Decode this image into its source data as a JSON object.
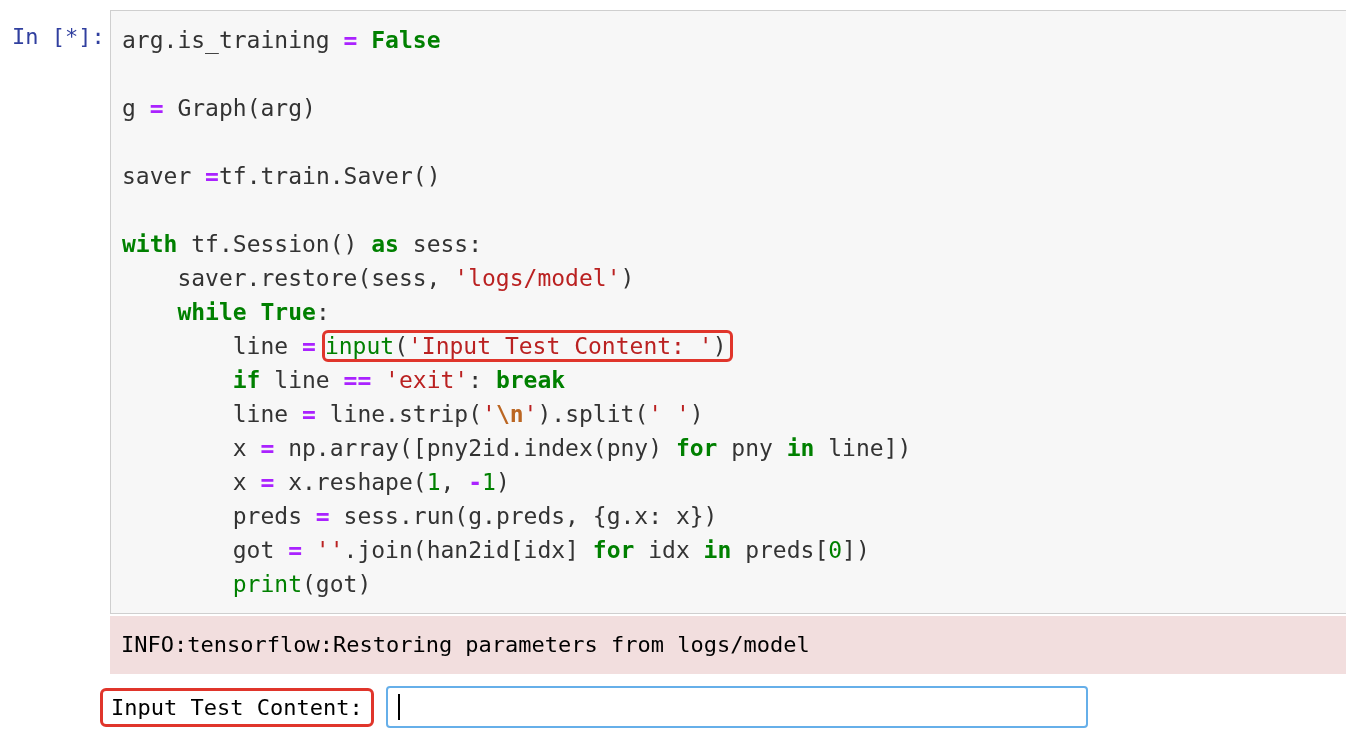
{
  "cell": {
    "prompt": "In [*]:",
    "blocks": [
      {
        "lines": [
          {
            "tokens": [
              {
                "kind": "plain",
                "text": "arg.is_training "
              },
              {
                "kind": "operator",
                "text": "="
              },
              {
                "kind": "keyword",
                "text": " False"
              }
            ]
          }
        ]
      },
      {
        "lines": [
          {
            "tokens": [
              {
                "kind": "plain",
                "text": "g "
              },
              {
                "kind": "operator",
                "text": "="
              },
              {
                "kind": "plain",
                "text": " Graph(arg)"
              }
            ]
          }
        ]
      },
      {
        "lines": [
          {
            "tokens": [
              {
                "kind": "plain",
                "text": "saver "
              },
              {
                "kind": "operator",
                "text": "="
              },
              {
                "kind": "plain",
                "text": "tf.train.Saver()"
              }
            ]
          }
        ]
      },
      {
        "lines": [
          {
            "tokens": [
              {
                "kind": "keyword",
                "text": "with"
              },
              {
                "kind": "plain",
                "text": " tf.Session() "
              },
              {
                "kind": "keyword",
                "text": "as"
              },
              {
                "kind": "plain",
                "text": " sess:"
              }
            ],
            "children": [
              {
                "tokens": [
                  {
                    "kind": "plain",
                    "text": "saver.restore(sess, "
                  },
                  {
                    "kind": "string",
                    "text": "'logs/model'"
                  },
                  {
                    "kind": "plain",
                    "text": ")"
                  }
                ]
              },
              {
                "tokens": [
                  {
                    "kind": "keyword",
                    "text": "while"
                  },
                  {
                    "kind": "keyword",
                    "text": " True"
                  },
                  {
                    "kind": "plain",
                    "text": ":"
                  }
                ],
                "children": [
                  {
                    "tokens": [
                      {
                        "kind": "plain",
                        "text": "line "
                      },
                      {
                        "kind": "operator",
                        "text": "="
                      }
                    ],
                    "boxed": [
                      {
                        "kind": "builtin",
                        "text": "input"
                      },
                      {
                        "kind": "plain",
                        "text": "("
                      },
                      {
                        "kind": "string",
                        "text": "'Input Test Content: '"
                      },
                      {
                        "kind": "plain",
                        "text": ")"
                      }
                    ]
                  },
                  {
                    "tokens": [
                      {
                        "kind": "keyword",
                        "text": "if"
                      },
                      {
                        "kind": "plain",
                        "text": " line "
                      },
                      {
                        "kind": "operator",
                        "text": "=="
                      },
                      {
                        "kind": "string",
                        "text": " 'exit'"
                      },
                      {
                        "kind": "plain",
                        "text": ": "
                      },
                      {
                        "kind": "keyword",
                        "text": "break"
                      }
                    ]
                  },
                  {
                    "tokens": [
                      {
                        "kind": "plain",
                        "text": "line "
                      },
                      {
                        "kind": "operator",
                        "text": "="
                      },
                      {
                        "kind": "plain",
                        "text": " line.strip("
                      },
                      {
                        "kind": "string",
                        "text": "'"
                      },
                      {
                        "kind": "escape",
                        "text": "\\n"
                      },
                      {
                        "kind": "string",
                        "text": "'"
                      },
                      {
                        "kind": "plain",
                        "text": ").split("
                      },
                      {
                        "kind": "string",
                        "text": "' '"
                      },
                      {
                        "kind": "plain",
                        "text": ")"
                      }
                    ]
                  },
                  {
                    "tokens": [
                      {
                        "kind": "plain",
                        "text": "x "
                      },
                      {
                        "kind": "operator",
                        "text": "="
                      },
                      {
                        "kind": "plain",
                        "text": " np.array([pny2id.index(pny) "
                      },
                      {
                        "kind": "keyword",
                        "text": "for"
                      },
                      {
                        "kind": "plain",
                        "text": " pny "
                      },
                      {
                        "kind": "keyword",
                        "text": "in"
                      },
                      {
                        "kind": "plain",
                        "text": " line])"
                      }
                    ]
                  },
                  {
                    "tokens": [
                      {
                        "kind": "plain",
                        "text": "x "
                      },
                      {
                        "kind": "operator",
                        "text": "="
                      },
                      {
                        "kind": "plain",
                        "text": " x.reshape("
                      },
                      {
                        "kind": "number",
                        "text": "1"
                      },
                      {
                        "kind": "plain",
                        "text": ", "
                      },
                      {
                        "kind": "operator",
                        "text": "-"
                      },
                      {
                        "kind": "number",
                        "text": "1"
                      },
                      {
                        "kind": "plain",
                        "text": ")"
                      }
                    ]
                  },
                  {
                    "tokens": [
                      {
                        "kind": "plain",
                        "text": "preds "
                      },
                      {
                        "kind": "operator",
                        "text": "="
                      },
                      {
                        "kind": "plain",
                        "text": " sess.run(g.preds, {g.x: x})"
                      }
                    ]
                  },
                  {
                    "tokens": [
                      {
                        "kind": "plain",
                        "text": "got "
                      },
                      {
                        "kind": "operator",
                        "text": "="
                      },
                      {
                        "kind": "string",
                        "text": " ''"
                      },
                      {
                        "kind": "plain",
                        "text": ".join(han2id[idx] "
                      },
                      {
                        "kind": "keyword",
                        "text": "for"
                      },
                      {
                        "kind": "plain",
                        "text": " idx "
                      },
                      {
                        "kind": "keyword",
                        "text": "in"
                      },
                      {
                        "kind": "plain",
                        "text": " preds["
                      },
                      {
                        "kind": "number",
                        "text": "0"
                      },
                      {
                        "kind": "plain",
                        "text": "])"
                      }
                    ]
                  },
                  {
                    "tokens": [
                      {
                        "kind": "builtin",
                        "text": "print"
                      },
                      {
                        "kind": "plain",
                        "text": "(got)"
                      }
                    ]
                  }
                ]
              }
            ]
          }
        ]
      }
    ]
  },
  "stderr": "INFO:tensorflow:Restoring parameters from logs/model",
  "stdin": {
    "prompt": "Input Test Content:",
    "boxed": true,
    "focused": true
  }
}
